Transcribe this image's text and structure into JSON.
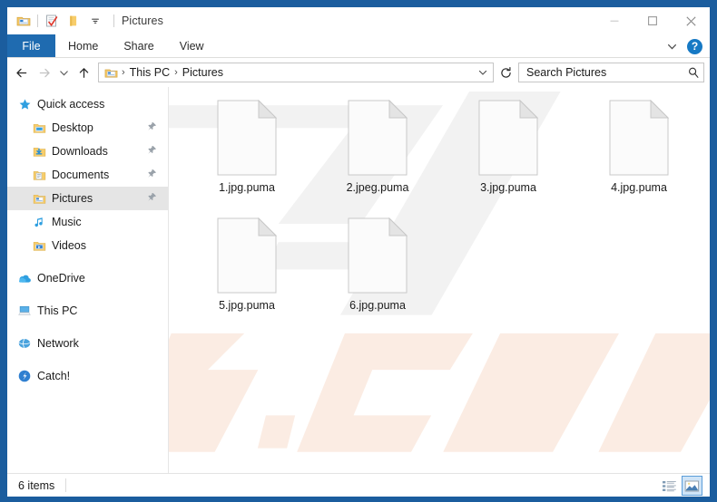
{
  "window": {
    "title": "Pictures",
    "frame_color": "#1b5d9e",
    "quick_access_toolbar": [
      {
        "name": "explorer-icon",
        "label": "File Explorer"
      },
      {
        "name": "properties-icon",
        "label": "Properties"
      },
      {
        "name": "new-folder-icon",
        "label": "New folder"
      },
      {
        "name": "customize-dropdown-icon",
        "label": "Customize Quick Access Toolbar"
      }
    ],
    "controls": {
      "minimize": "Minimize",
      "maximize": "Maximize",
      "close": "Close"
    }
  },
  "ribbon": {
    "tabs": [
      {
        "label": "File",
        "active": true
      },
      {
        "label": "Home",
        "active": false
      },
      {
        "label": "Share",
        "active": false
      },
      {
        "label": "View",
        "active": false
      }
    ],
    "collapse_label": "Minimize the Ribbon",
    "help_label": "?"
  },
  "navbar": {
    "back_label": "Back",
    "forward_label": "Forward",
    "recent_label": "Recent locations",
    "up_label": "Up",
    "breadcrumbs": [
      {
        "label": "This PC"
      },
      {
        "label": "Pictures"
      }
    ],
    "crumb_separator": "›",
    "dropdown_label": "Previous locations",
    "refresh_label": "Refresh",
    "search": {
      "placeholder": "Search Pictures",
      "value": "",
      "icon": "search-icon"
    }
  },
  "sidebar": {
    "groups": [
      {
        "header": {
          "label": "Quick access",
          "icon": "star-icon"
        },
        "items": [
          {
            "label": "Desktop",
            "icon": "folder-desktop-icon",
            "pinned": true,
            "selected": false
          },
          {
            "label": "Downloads",
            "icon": "folder-downloads-icon",
            "pinned": true,
            "selected": false
          },
          {
            "label": "Documents",
            "icon": "folder-documents-icon",
            "pinned": true,
            "selected": false
          },
          {
            "label": "Pictures",
            "icon": "folder-pictures-icon",
            "pinned": true,
            "selected": true
          },
          {
            "label": "Music",
            "icon": "music-note-icon",
            "pinned": false,
            "selected": false
          },
          {
            "label": "Videos",
            "icon": "folder-videos-icon",
            "pinned": false,
            "selected": false
          }
        ]
      },
      {
        "header": null,
        "items": [
          {
            "label": "OneDrive",
            "icon": "onedrive-cloud-icon",
            "pinned": false,
            "selected": false
          }
        ]
      },
      {
        "header": null,
        "items": [
          {
            "label": "This PC",
            "icon": "this-pc-icon",
            "pinned": false,
            "selected": false
          }
        ]
      },
      {
        "header": null,
        "items": [
          {
            "label": "Network",
            "icon": "network-icon",
            "pinned": false,
            "selected": false
          }
        ]
      },
      {
        "header": null,
        "items": [
          {
            "label": "Catch!",
            "icon": "catch-app-icon",
            "pinned": false,
            "selected": false
          }
        ]
      }
    ]
  },
  "content": {
    "watermark_text": "risk.com",
    "watermark_color": "#fbeee7",
    "files": [
      {
        "name": "1.jpg.puma",
        "icon": "blank-document-icon"
      },
      {
        "name": "2.jpeg.puma",
        "icon": "blank-document-icon"
      },
      {
        "name": "3.jpg.puma",
        "icon": "blank-document-icon"
      },
      {
        "name": "4.jpg.puma",
        "icon": "blank-document-icon"
      },
      {
        "name": "5.jpg.puma",
        "icon": "blank-document-icon"
      },
      {
        "name": "6.jpg.puma",
        "icon": "blank-document-icon"
      }
    ]
  },
  "statusbar": {
    "item_count": "6 items",
    "views": [
      {
        "name": "details-view-button",
        "label": "Details view",
        "active": false
      },
      {
        "name": "large-icons-view-button",
        "label": "Large icons view",
        "active": true
      }
    ]
  }
}
